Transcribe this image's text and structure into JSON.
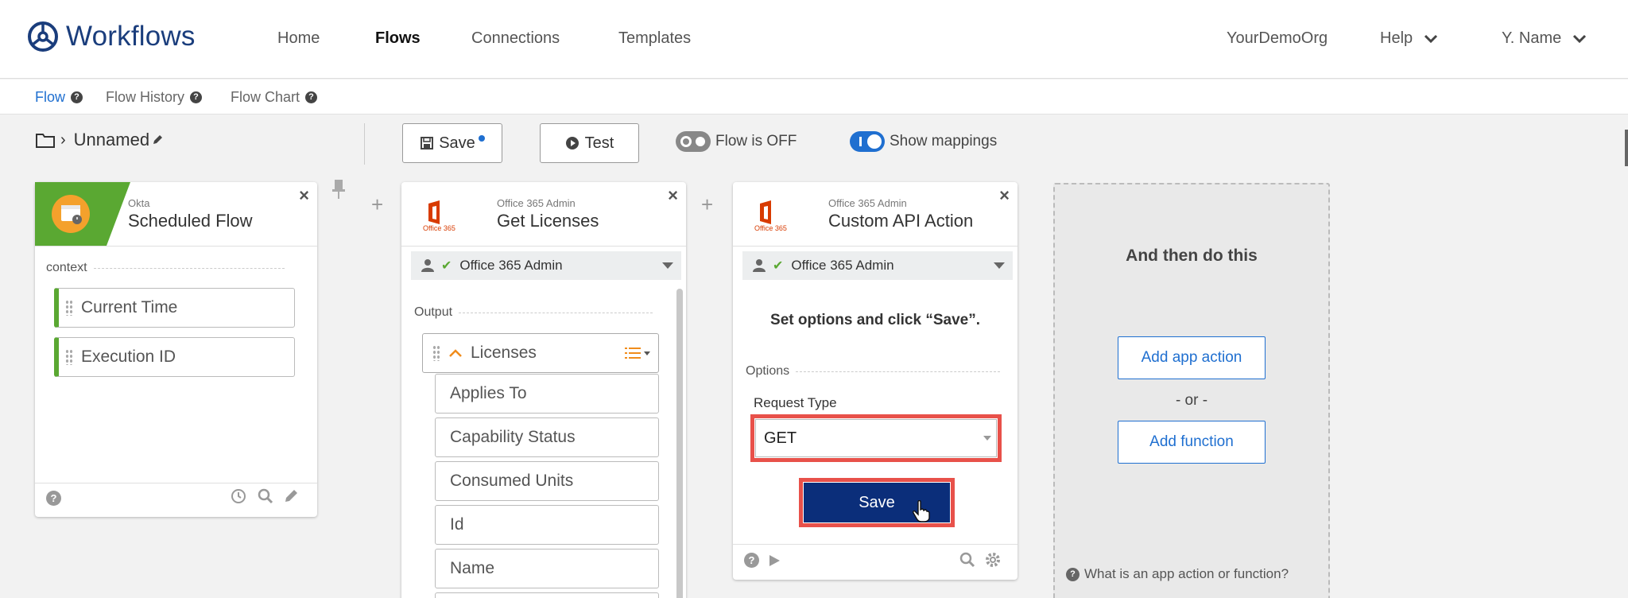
{
  "app": {
    "title": "Workflows"
  },
  "nav": {
    "items": [
      {
        "label": "Home",
        "active": false
      },
      {
        "label": "Flows",
        "active": true
      },
      {
        "label": "Connections",
        "active": false
      },
      {
        "label": "Templates",
        "active": false
      }
    ],
    "org": "YourDemoOrg",
    "help": "Help",
    "user": "Y. Name"
  },
  "subnav": {
    "items": [
      {
        "label": "Flow",
        "active": true
      },
      {
        "label": "Flow History",
        "active": false
      },
      {
        "label": "Flow Chart",
        "active": false
      }
    ]
  },
  "toolbar": {
    "breadcrumb": "Unnamed",
    "save_label": "Save",
    "test_label": "Test",
    "flow_toggle_label": "Flow is OFF",
    "mappings_toggle_label": "Show mappings"
  },
  "cards": {
    "scheduled": {
      "vendor": "Okta",
      "title": "Scheduled Flow",
      "section": "context",
      "fields": [
        "Current Time",
        "Execution ID"
      ]
    },
    "licenses": {
      "vendor": "Office 365 Admin",
      "logo_caption": "Office 365",
      "title": "Get Licenses",
      "connection": "Office 365 Admin",
      "section": "Output",
      "group": "Licenses",
      "fields": [
        "Applies To",
        "Capability Status",
        "Consumed Units",
        "Id",
        "Name"
      ]
    },
    "custom_api": {
      "vendor": "Office 365 Admin",
      "logo_caption": "Office 365",
      "title": "Custom API Action",
      "connection": "Office 365 Admin",
      "instruction": "Set options and click “Save”.",
      "section": "Options",
      "request_type_label": "Request Type",
      "request_type_value": "GET",
      "save_label": "Save"
    }
  },
  "placeholder": {
    "title": "And then do this",
    "add_action": "Add app action",
    "or": "- or -",
    "add_function": "Add function",
    "help": "What is an app action or function?"
  },
  "colors": {
    "brand": "#1a3d7c",
    "accent": "#1f6fd0",
    "okta_green": "#5aa832",
    "office_red": "#d83b01",
    "highlight": "#e8514a",
    "primary_button": "#0b2e7a"
  }
}
